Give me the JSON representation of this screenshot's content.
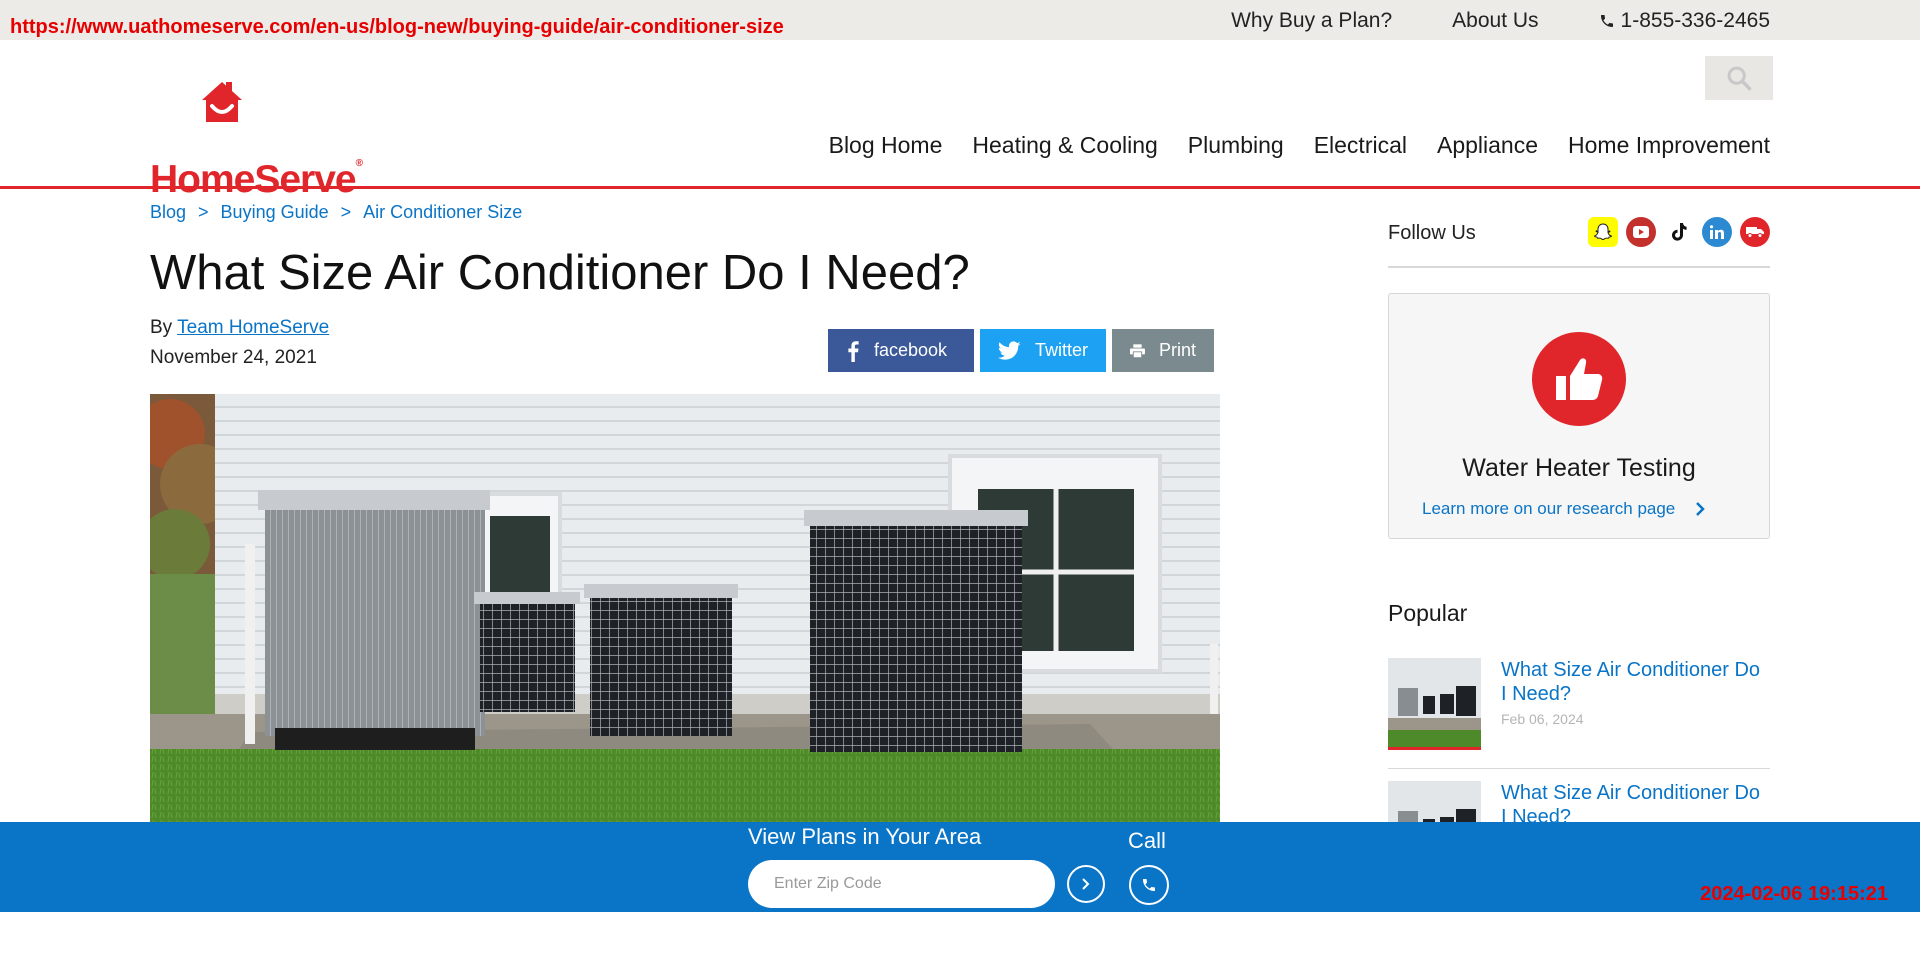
{
  "overlay": {
    "url": "https://www.uathomeserve.com/en-us/blog-new/buying-guide/air-conditioner-size",
    "timestamp": "2024-02-06 19:15:21"
  },
  "top_links": {
    "why_buy": "Why Buy a Plan?",
    "about": "About Us",
    "phone": "1-855-336-2465"
  },
  "brand": {
    "name": "HomeServe",
    "reg": "®",
    "color": "#e0262b"
  },
  "nav": [
    "Blog Home",
    "Heating & Cooling",
    "Plumbing",
    "Electrical",
    "Appliance",
    "Home Improvement"
  ],
  "breadcrumb": {
    "items": [
      "Blog",
      "Buying Guide",
      "Air Conditioner Size"
    ],
    "separator": ">"
  },
  "article": {
    "title": "What Size Air Conditioner Do I Need?",
    "by": "By",
    "author": "Team HomeServe",
    "date": "November 24, 2021"
  },
  "share": {
    "facebook": "facebook",
    "twitter": "Twitter",
    "print": "Print"
  },
  "sidebar": {
    "follow_label": "Follow Us",
    "social_icons": [
      "snapchat-icon",
      "youtube-icon",
      "tiktok-icon",
      "linkedin-icon",
      "truck-icon"
    ],
    "promo": {
      "title": "Water Heater Testing",
      "link": "Learn more on our research page"
    },
    "popular_label": "Popular",
    "popular": [
      {
        "title": "What Size Air Conditioner Do I Need?",
        "date": "Feb 06, 2024"
      },
      {
        "title": "What Size Air Conditioner Do I Need?",
        "date": ""
      }
    ]
  },
  "sticky": {
    "plans_label": "View Plans in Your Area",
    "zip_placeholder": "Enter Zip Code",
    "call_label": "Call"
  },
  "colors": {
    "accent_blue": "#0a74c7",
    "facebook": "#3b5998",
    "twitter": "#1da1f2",
    "print": "#7b8a8e"
  }
}
